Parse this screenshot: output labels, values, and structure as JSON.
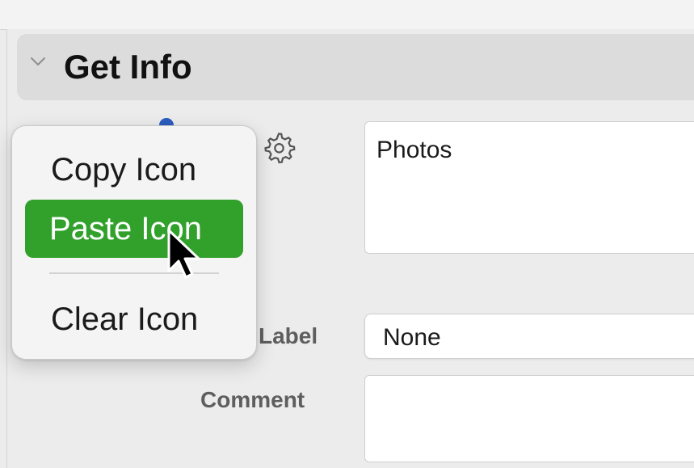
{
  "section": {
    "title": "Get Info"
  },
  "general": {
    "name_value": "Photos"
  },
  "fields": {
    "label": {
      "title": "Label",
      "value": "None"
    },
    "comment": {
      "title": "Comment",
      "value": ""
    }
  },
  "context_menu": {
    "items": [
      {
        "label": "Copy Icon"
      },
      {
        "label": "Paste Icon",
        "highlighted": true
      },
      {
        "label": "Clear Icon"
      }
    ]
  },
  "colors": {
    "menu_highlight": "#31a12c",
    "header_background": "#dcdcdc",
    "window_background": "#ececec"
  },
  "icons": [
    "chevron-down-icon",
    "gear-icon",
    "cursor-arrow-icon"
  ]
}
